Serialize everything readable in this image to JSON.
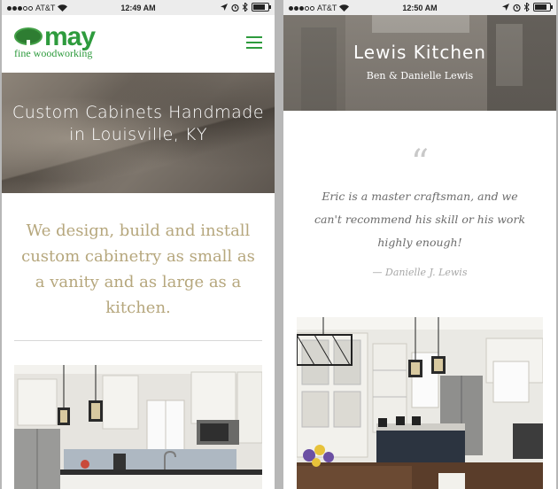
{
  "left_phone": {
    "status": {
      "carrier": "AT&T",
      "time": "12:49 AM"
    },
    "logo": {
      "word": "may",
      "tagline": "fine woodworking"
    },
    "hero": {
      "title": "Custom Cabinets Handmade in Louisville, KY"
    },
    "intro": "We design, build and install custom cabinetry as small as a vanity and as large as a kitchen."
  },
  "right_phone": {
    "status": {
      "carrier": "AT&T",
      "time": "12:50 AM"
    },
    "hero": {
      "title": "Lewis Kitchen",
      "subtitle": "Ben & Danielle Lewis"
    },
    "quote_mark": "“",
    "quote": "Eric is a master craftsman, and we can't recommend his skill or his work highly enough!",
    "attribution": "— Danielle J. Lewis"
  },
  "colors": {
    "brand_green": "#2e9b3d",
    "intro_tan": "#b6a77d"
  },
  "icons": [
    "wifi-icon",
    "location-arrow-icon",
    "alarm-icon",
    "bluetooth-icon",
    "battery-icon",
    "hamburger-menu-icon",
    "quote-icon"
  ]
}
